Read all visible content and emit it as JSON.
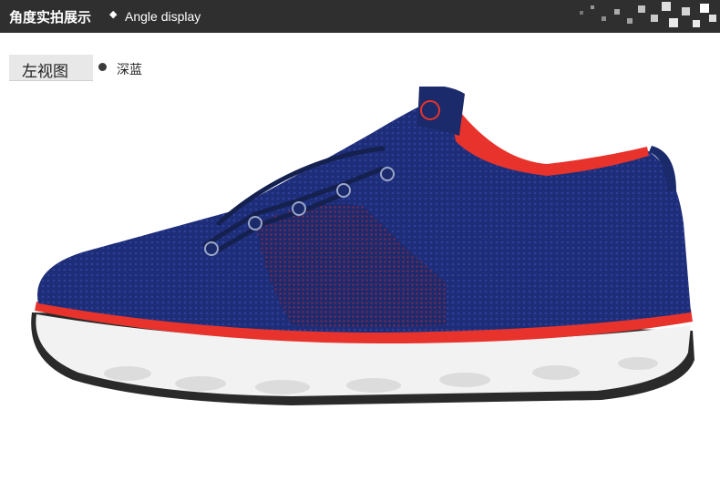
{
  "header": {
    "title": "角度实拍展示",
    "separator": "◆",
    "subtitle": "Angle display"
  },
  "view": {
    "label": "左视图",
    "color_name": "深蓝"
  },
  "colors": {
    "header_bg": "#2f2f2f",
    "shoe_upper": "#1e2d78",
    "accent_red": "#e8332c",
    "sole_white": "#f2f2f2"
  },
  "icons": {
    "color_dot": "bullet-dot-icon",
    "decoration": "pixel-mosaic-icon"
  }
}
